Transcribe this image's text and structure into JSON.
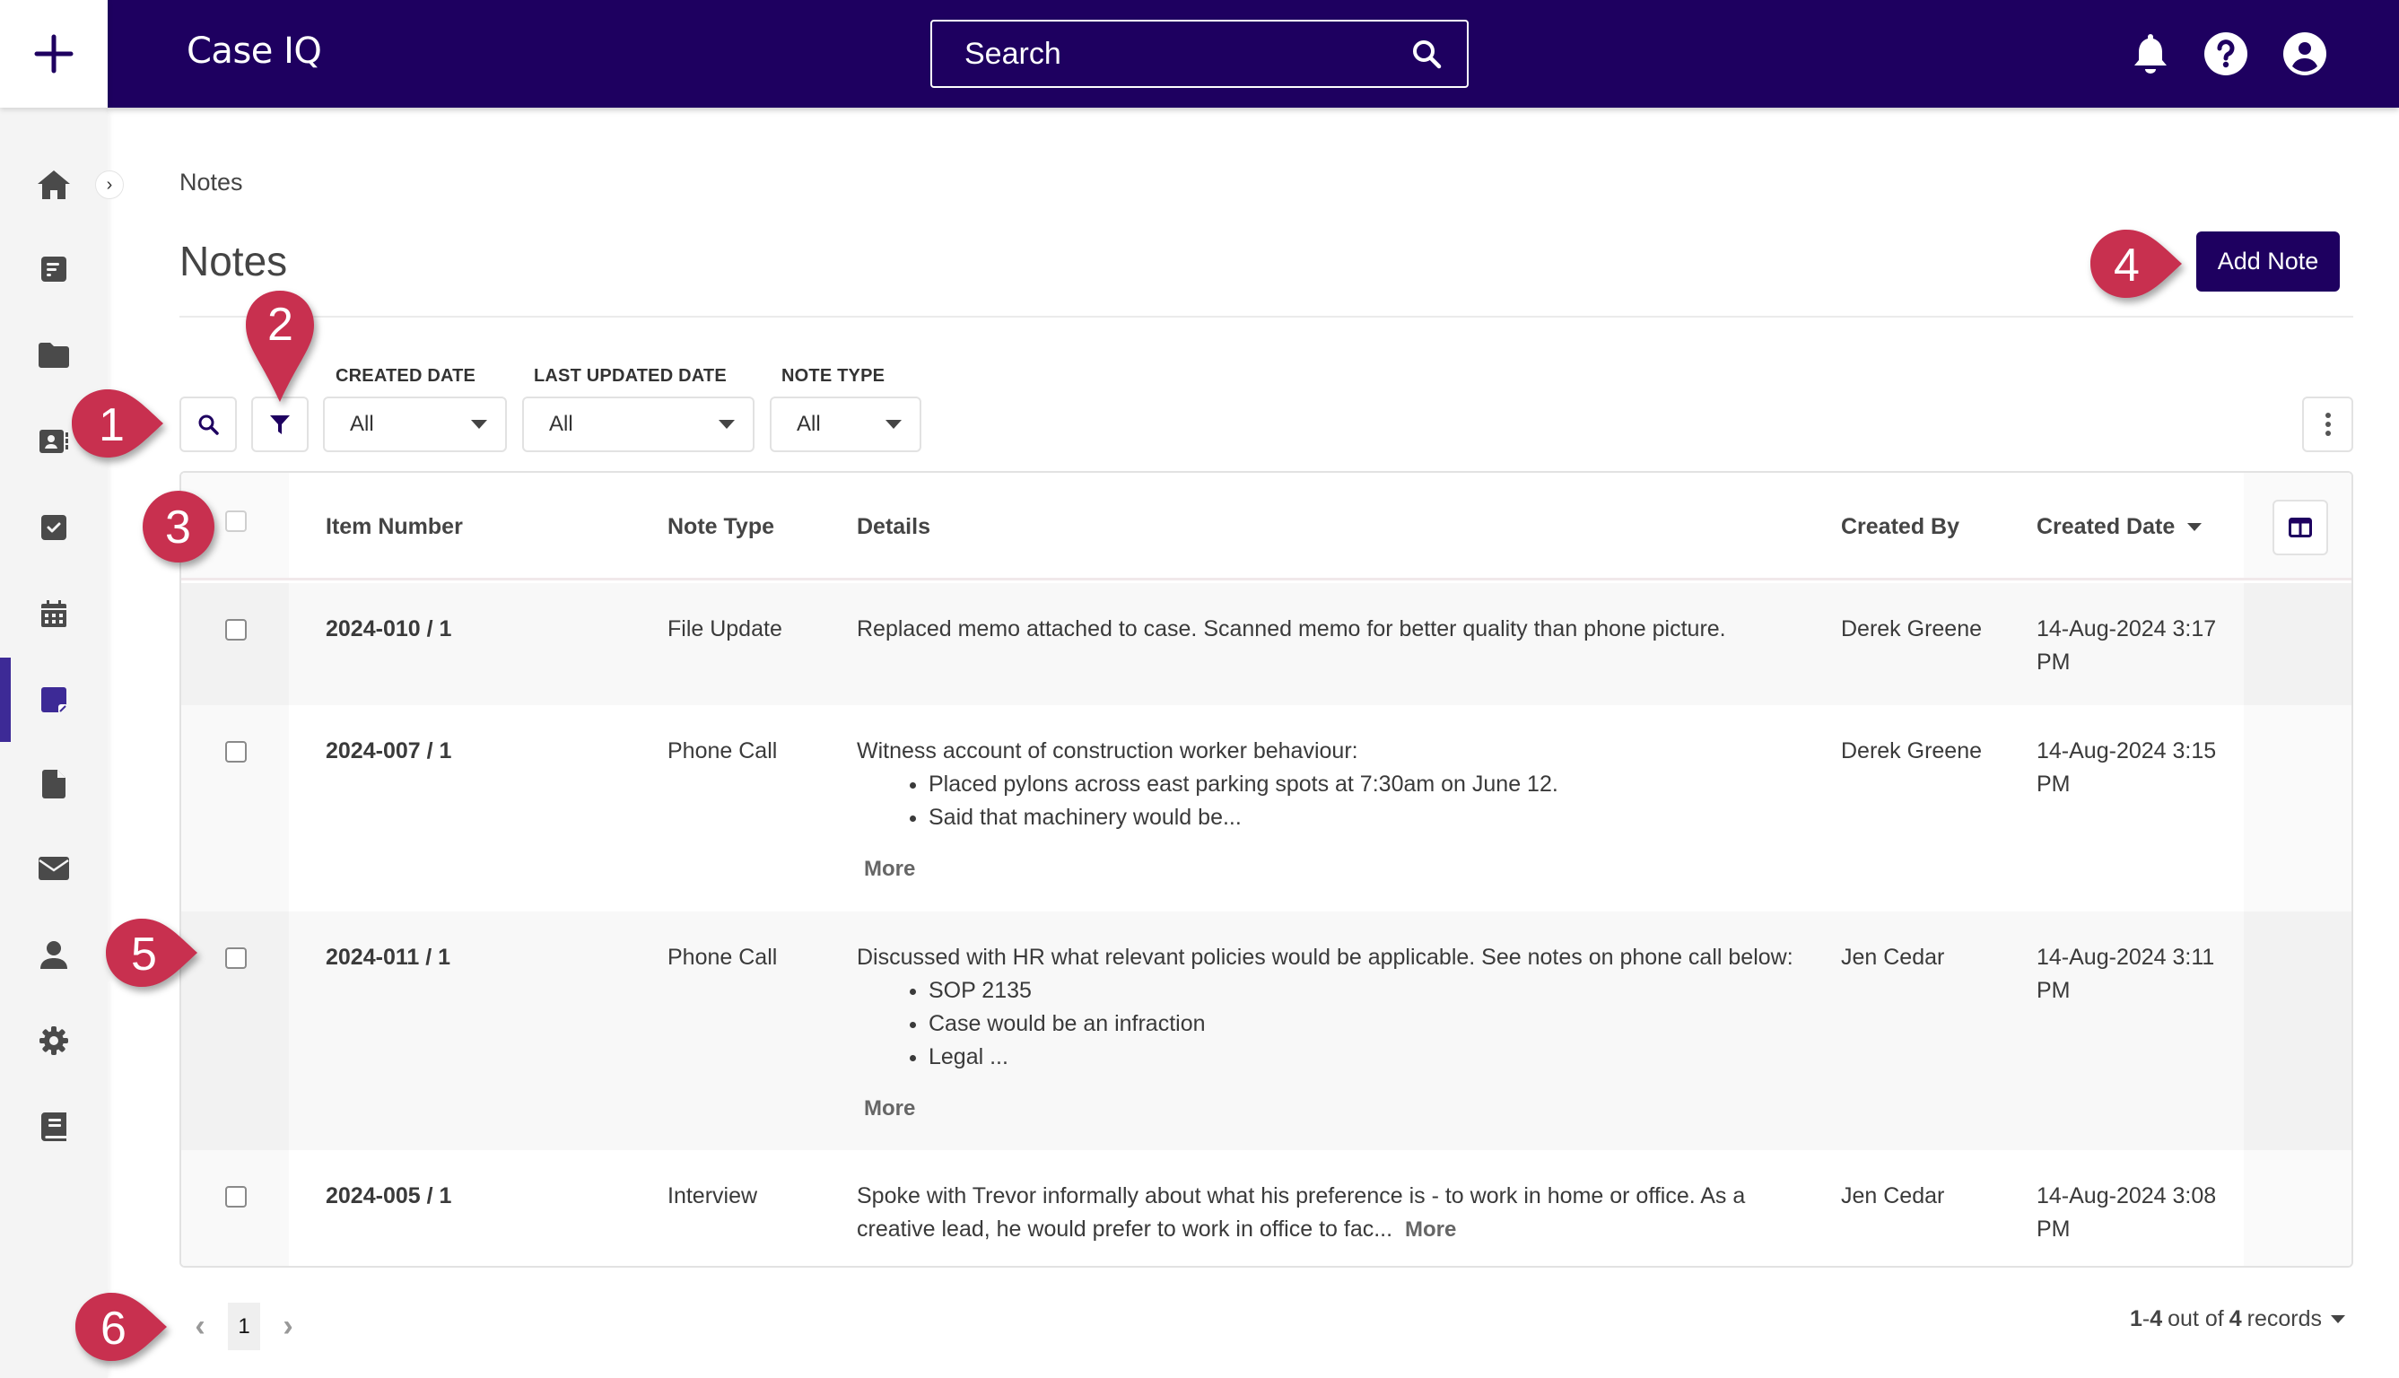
{
  "app": {
    "name": "Case IQ",
    "add_icon": "plus-icon"
  },
  "header": {
    "search_placeholder": "Search",
    "icons": [
      "search-icon",
      "bell-icon",
      "help-icon",
      "user-account-icon"
    ]
  },
  "sidebar": {
    "expand_label": "›",
    "items": [
      {
        "name": "home",
        "icon": "home-icon",
        "active": false
      },
      {
        "name": "dashboard",
        "icon": "dashboard-icon",
        "active": false
      },
      {
        "name": "cases",
        "icon": "folder-icon",
        "active": false
      },
      {
        "name": "contacts",
        "icon": "contact-card-icon",
        "active": false
      },
      {
        "name": "tasks",
        "icon": "checkbox-icon",
        "active": false
      },
      {
        "name": "calendar",
        "icon": "calendar-icon",
        "active": false
      },
      {
        "name": "notes",
        "icon": "sticky-note-icon",
        "active": true
      },
      {
        "name": "documents",
        "icon": "file-icon",
        "active": false
      },
      {
        "name": "mail",
        "icon": "envelope-icon",
        "active": false
      },
      {
        "name": "users",
        "icon": "person-icon",
        "active": false
      },
      {
        "name": "settings",
        "icon": "gear-icon",
        "active": false
      },
      {
        "name": "library",
        "icon": "book-icon",
        "active": false
      }
    ],
    "accent_color": "#3d2a96"
  },
  "page": {
    "breadcrumb": "Notes",
    "title": "Notes",
    "add_button": "Add Note"
  },
  "filters": {
    "created_date": {
      "label": "CREATED DATE",
      "value": "All"
    },
    "last_updated_date": {
      "label": "LAST UPDATED DATE",
      "value": "All"
    },
    "note_type": {
      "label": "NOTE TYPE",
      "value": "All"
    }
  },
  "table": {
    "columns": {
      "item_number": "Item Number",
      "note_type": "Note Type",
      "details": "Details",
      "created_by": "Created By",
      "created_date": "Created Date"
    },
    "sort": {
      "column": "Created Date",
      "direction": "descending"
    },
    "more_label": "More",
    "rows": [
      {
        "item_number": "2024-010 / 1",
        "note_type": "File Update",
        "details_text": "Replaced memo attached to case. Scanned memo for better quality than phone picture.",
        "details_bullets": [],
        "created_by": "Derek Greene",
        "created_date_line1": "14-Aug-2024 3:17",
        "created_date_line2": "PM"
      },
      {
        "item_number": "2024-007 / 1",
        "note_type": "Phone Call",
        "details_text": "Witness account of construction worker behaviour:",
        "details_bullets": [
          "Placed pylons across east parking spots at 7:30am on June 12.",
          "Said that machinery would be..."
        ],
        "more": "More",
        "created_by": "Derek Greene",
        "created_date_line1": "14-Aug-2024 3:15",
        "created_date_line2": "PM"
      },
      {
        "item_number": "2024-011 / 1",
        "note_type": "Phone Call",
        "details_text": "Discussed with HR what relevant policies would be applicable. See notes on phone call below:",
        "details_bullets": [
          "SOP 2135",
          "Case would be an infraction",
          "Legal ..."
        ],
        "more": "More",
        "created_by": "Jen Cedar",
        "created_date_line1": "14-Aug-2024 3:11",
        "created_date_line2": "PM"
      },
      {
        "item_number": "2024-005 / 1",
        "note_type": "Interview",
        "details_line1": "Spoke with Trevor informally about what his preference is - to work in home or office. As a",
        "details_line2": "creative lead, he would prefer to work in office to fac...",
        "more": "More",
        "created_by": "Jen Cedar",
        "created_date_line1": "14-Aug-2024 3:08",
        "created_date_line2": "PM"
      }
    ]
  },
  "pagination": {
    "current_page": "1",
    "range_start": "1",
    "range_end": "4",
    "total": "4",
    "sep": "-",
    "out_of": "out of",
    "records": "records"
  },
  "callouts": [
    "1",
    "2",
    "3",
    "4",
    "5",
    "6"
  ],
  "colors": {
    "brand": "#1e0060",
    "callout": "#c8304f"
  }
}
